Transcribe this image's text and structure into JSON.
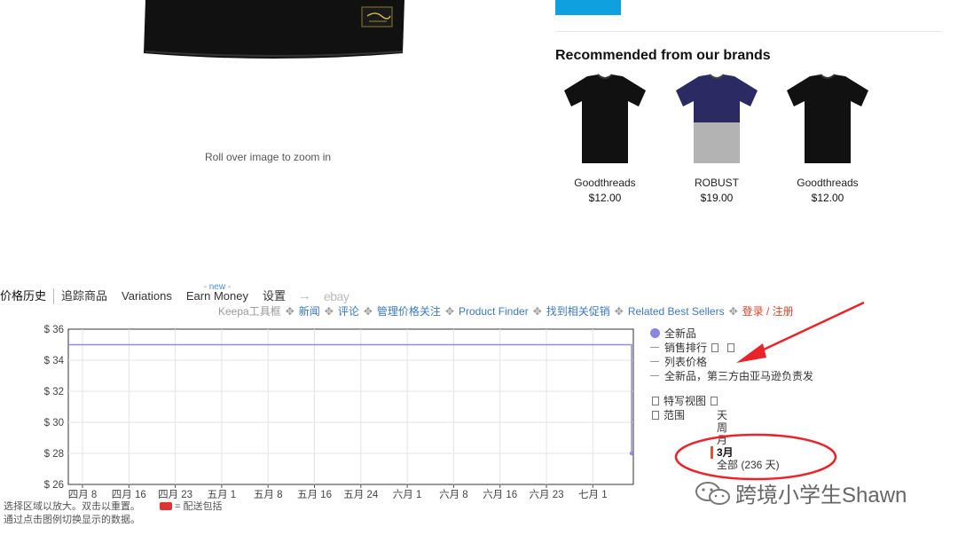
{
  "product": {
    "zoom_hint": "Roll over image to zoom in"
  },
  "recommended": {
    "title": "Recommended from our brands",
    "items": [
      {
        "brand": "Goodthreads",
        "price": "$12.00",
        "color_top": "#111111",
        "color_bottom": "#111111"
      },
      {
        "brand": "ROBUST",
        "price": "$19.00",
        "color_top": "#2c2a63",
        "color_bottom": "#b3b3b3"
      },
      {
        "brand": "Goodthreads",
        "price": "$12.00",
        "color_top": "#111111",
        "color_bottom": "#111111"
      }
    ]
  },
  "keepa": {
    "tabs": {
      "price_history": "价格历史",
      "tracking": "追踪商品",
      "variations": "Variations",
      "earn_new": "- new -",
      "earn": "Earn Money",
      "settings": "设置",
      "arrow": "→",
      "ebay": "ebay"
    },
    "links": {
      "toolbox": "Keepa工具框",
      "news": "新闻",
      "reviews": "评论",
      "manage": "管理价格关注",
      "finder": "Product Finder",
      "deals": "找到相关促销",
      "best_sellers": "Related Best Sellers",
      "login": "登录 / 注册"
    },
    "legend": {
      "new": "全新品",
      "sales_rank": "销售排行",
      "list_price": "列表价格",
      "new_3p": "全新品，第三方由亚马逊负责发",
      "close_up": "特写视图",
      "range": "范围"
    },
    "range_options": {
      "day": "天",
      "week": "周",
      "month": "月",
      "three_months": "3月",
      "all": "全部 (236 天)"
    },
    "footnote": {
      "line1": "选择区域以放大。双击以重置。",
      "shipping": "= 配送包括",
      "line2": "通过点击图例切换显示的数据。"
    }
  },
  "chart_data": {
    "type": "line",
    "y_tick_labels": [
      "$ 36",
      "$ 34",
      "$ 32",
      "$ 30",
      "$ 28",
      "$ 26"
    ],
    "y_ticks": [
      36,
      34,
      32,
      30,
      28,
      26
    ],
    "ylim": [
      26,
      36
    ],
    "x_tick_labels": [
      "四月 8",
      "四月 16",
      "四月 23",
      "五月 1",
      "五月 8",
      "五月 16",
      "五月 24",
      "六月 1",
      "六月 8",
      "六月 16",
      "六月 23",
      "七月 1"
    ],
    "series": [
      {
        "name": "全新品",
        "color": "#8a8fe0",
        "points": [
          {
            "x": "四月 1",
            "y": 35
          },
          {
            "x": "七月 5",
            "y": 35
          },
          {
            "x": "七月 5",
            "y": 28
          }
        ]
      }
    ],
    "grid": true
  },
  "watermark": {
    "text": "跨境小学生Shawn"
  },
  "colors": {
    "accent_blue": "#0fa0e0",
    "link_blue": "#3b78c2",
    "annotation_red": "#e8242a"
  }
}
